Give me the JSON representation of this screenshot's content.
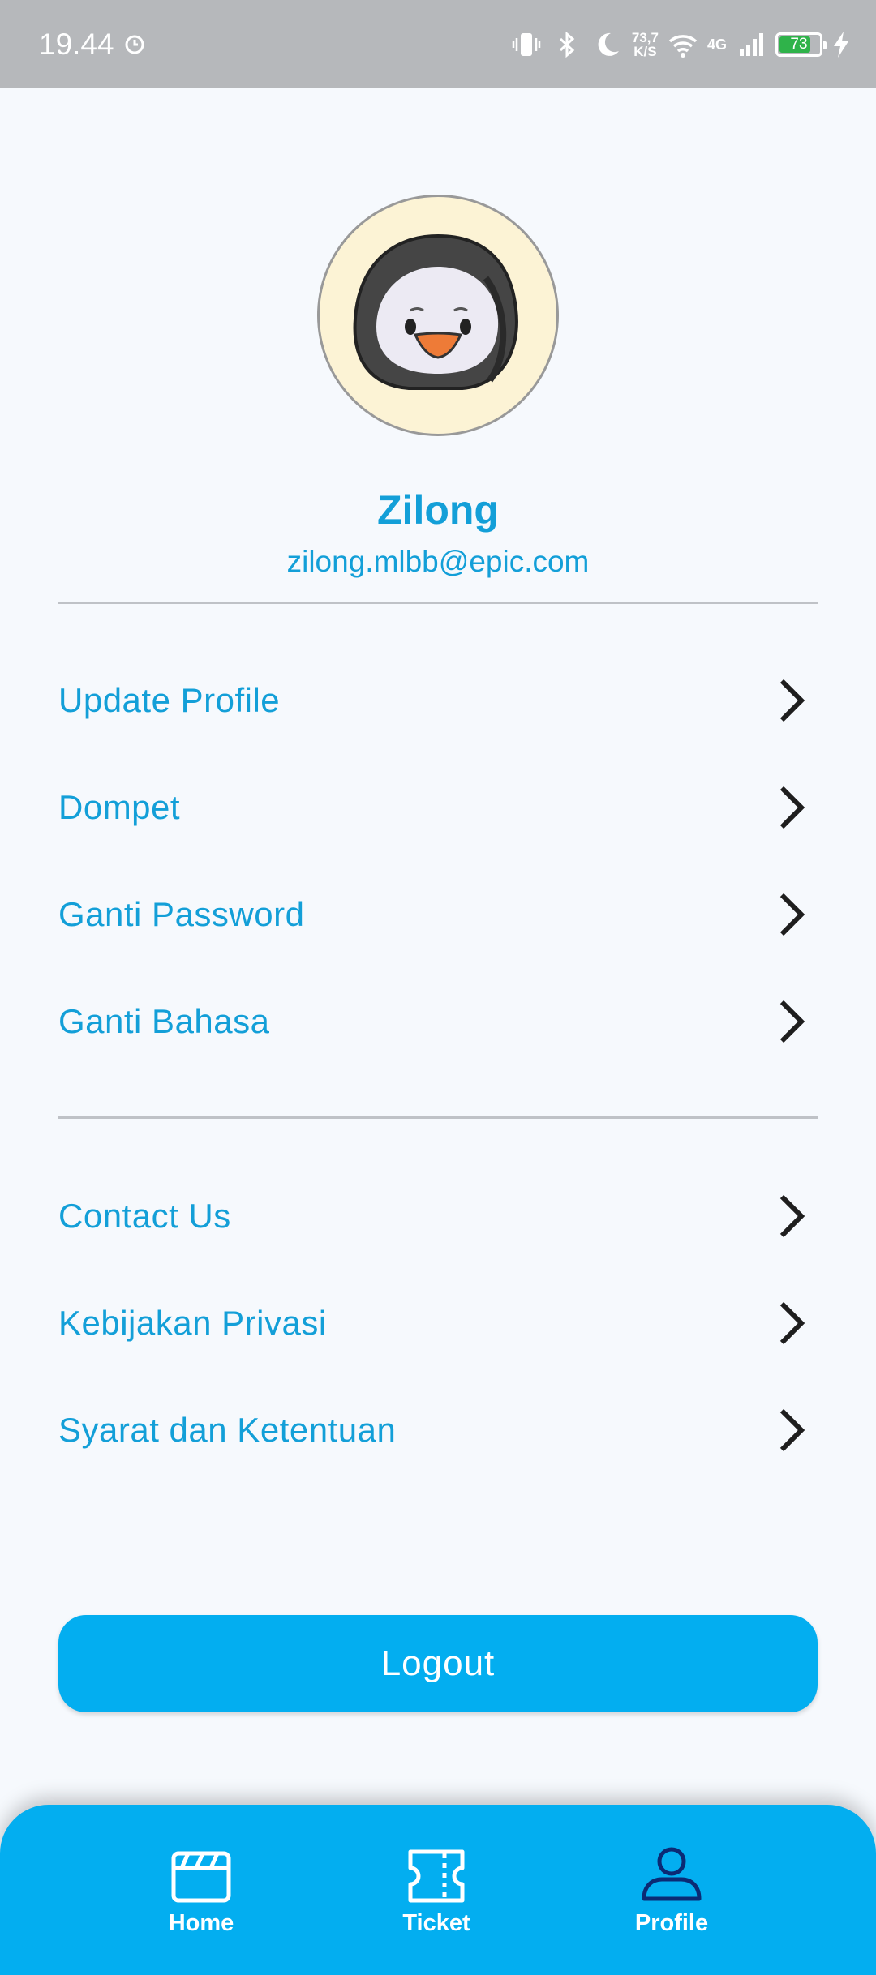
{
  "status_bar": {
    "time": "19.44",
    "speed_top": "73,7",
    "speed_unit": "K/S",
    "network": "4G",
    "battery": "73"
  },
  "profile": {
    "name": "Zilong",
    "email": "zilong.mlbb@epic.com"
  },
  "menu_account": [
    {
      "label": "Update Profile"
    },
    {
      "label": "Dompet"
    },
    {
      "label": "Ganti Password"
    },
    {
      "label": "Ganti Bahasa"
    }
  ],
  "menu_info": [
    {
      "label": "Contact Us"
    },
    {
      "label": "Kebijakan Privasi"
    },
    {
      "label": "Syarat dan Ketentuan"
    }
  ],
  "logout_label": "Logout",
  "bottom_nav": {
    "home": "Home",
    "ticket": "Ticket",
    "profile": "Profile",
    "active": "profile"
  },
  "colors": {
    "accent": "#03aef0",
    "text_accent": "#139fd8",
    "background": "#f6f9fd",
    "status_bar": "#b6b8bb"
  }
}
